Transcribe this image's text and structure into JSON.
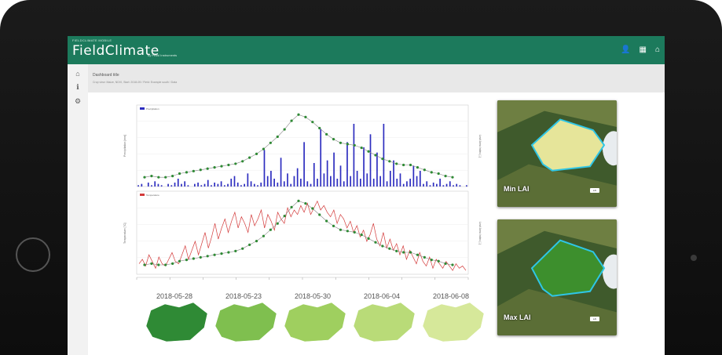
{
  "app": {
    "brand_small": "FIELDCLIMATE MOBILE",
    "brand": "FieldClimate",
    "brand_sub": "by Pessl Instruments"
  },
  "subheader": {
    "title": "Dashboard title",
    "path": "Crop view: Maize, NDVI, Start: 2018-05 / Field: Example south / Data"
  },
  "icons": {
    "top": [
      "user-icon",
      "book-icon",
      "home-icon"
    ],
    "side": [
      "home-icon",
      "info-icon",
      "gear-icon"
    ]
  },
  "colors": {
    "topbar": "#1c7a5c",
    "precip": "#2d2dbf",
    "temp": "#d33a3a",
    "lai": "#2f8a35",
    "boundary": "#2ec6e6"
  },
  "chart_data": [
    {
      "type": "bar",
      "legend": [
        "Precipitation"
      ],
      "ylabel_left": "Precipitation [mm]",
      "ylabel_right": "Leaf Area Index [-]",
      "ylim": [
        0,
        60
      ],
      "y2lim": [
        0,
        6
      ],
      "series": [
        {
          "name": "Precipitation",
          "values": [
            1,
            2,
            0,
            3,
            1,
            4,
            2,
            1,
            0,
            2,
            1,
            3,
            6,
            2,
            4,
            1,
            0,
            2,
            3,
            1,
            2,
            5,
            1,
            3,
            2,
            4,
            1,
            2,
            6,
            8,
            3,
            1,
            2,
            10,
            4,
            2,
            1,
            3,
            28,
            8,
            12,
            6,
            3,
            22,
            4,
            10,
            2,
            8,
            14,
            6,
            34,
            4,
            2,
            18,
            6,
            44,
            10,
            20,
            8,
            26,
            6,
            16,
            4,
            34,
            8,
            48,
            12,
            6,
            30,
            10,
            40,
            6,
            26,
            8,
            48,
            4,
            12,
            20,
            6,
            10,
            2,
            4,
            6,
            16,
            8,
            12,
            2,
            4,
            1,
            3,
            2,
            6,
            1,
            2,
            4,
            1,
            2,
            1,
            0,
            1
          ]
        },
        {
          "name": "LAI",
          "values": [
            0.5,
            0.6,
            0.5,
            0.5,
            0.6,
            0.8,
            0.9,
            1.0,
            1.1,
            1.2,
            1.3,
            1.4,
            1.5,
            1.6,
            1.8,
            2.1,
            2.4,
            2.8,
            3.3,
            3.8,
            4.4,
            5.1,
            5.6,
            5.4,
            5.0,
            4.5,
            4.0,
            3.6,
            3.3,
            3.2,
            3.1,
            2.9,
            2.6,
            2.3,
            2.0,
            1.8,
            1.6,
            1.5,
            1.5,
            1.3,
            1.1,
            0.9,
            0.8,
            0.6,
            0.5
          ]
        }
      ]
    },
    {
      "type": "line",
      "legend": [
        "Temperature"
      ],
      "ylabel_left": "Temperature [°C]",
      "ylabel_right": "Leaf Area Index [-]",
      "ylim": [
        0,
        35
      ],
      "y2lim": [
        0,
        6
      ],
      "series": [
        {
          "name": "Temperature",
          "values": [
            4,
            6,
            3,
            8,
            5,
            2,
            7,
            4,
            3,
            6,
            9,
            5,
            4,
            8,
            12,
            6,
            10,
            14,
            8,
            13,
            18,
            11,
            16,
            22,
            15,
            20,
            24,
            18,
            23,
            27,
            20,
            25,
            22,
            18,
            26,
            21,
            24,
            28,
            20,
            26,
            23,
            19,
            27,
            24,
            22,
            29,
            25,
            28,
            26,
            30,
            27,
            31,
            26,
            29,
            32,
            28,
            30,
            27,
            25,
            28,
            22,
            26,
            24,
            20,
            23,
            18,
            21,
            16,
            19,
            14,
            17,
            22,
            15,
            12,
            18,
            11,
            15,
            10,
            13,
            8,
            12,
            6,
            10,
            7,
            4,
            9,
            5,
            3,
            7,
            2,
            6,
            4,
            2,
            5,
            3,
            1,
            4,
            2,
            3,
            1
          ]
        },
        {
          "name": "LAI",
          "values": [
            0.5,
            0.6,
            0.5,
            0.5,
            0.6,
            0.8,
            0.9,
            1.0,
            1.1,
            1.2,
            1.3,
            1.4,
            1.5,
            1.6,
            1.8,
            2.1,
            2.4,
            2.8,
            3.3,
            3.8,
            4.4,
            5.1,
            5.6,
            5.4,
            5.0,
            4.5,
            4.0,
            3.6,
            3.3,
            3.2,
            3.1,
            2.9,
            2.6,
            2.3,
            2.0,
            1.8,
            1.6,
            1.5,
            1.5,
            1.3,
            1.1,
            0.9,
            0.8,
            0.6,
            0.5
          ]
        }
      ]
    }
  ],
  "timeline": {
    "dates": [
      "2018-05-28",
      "2018-05-23",
      "2018-05-30",
      "2018-06-04",
      "2018-06-08"
    ],
    "colors": [
      "#2f8a35",
      "#7fbf4f",
      "#9fcf5f",
      "#b9db78",
      "#d6e89a"
    ]
  },
  "satellite": [
    {
      "label": "Min LAI",
      "field_color": "#e6e59a",
      "badge": "LAI"
    },
    {
      "label": "Max LAI",
      "field_color": "#3d8f2d",
      "badge": "LAI"
    }
  ]
}
